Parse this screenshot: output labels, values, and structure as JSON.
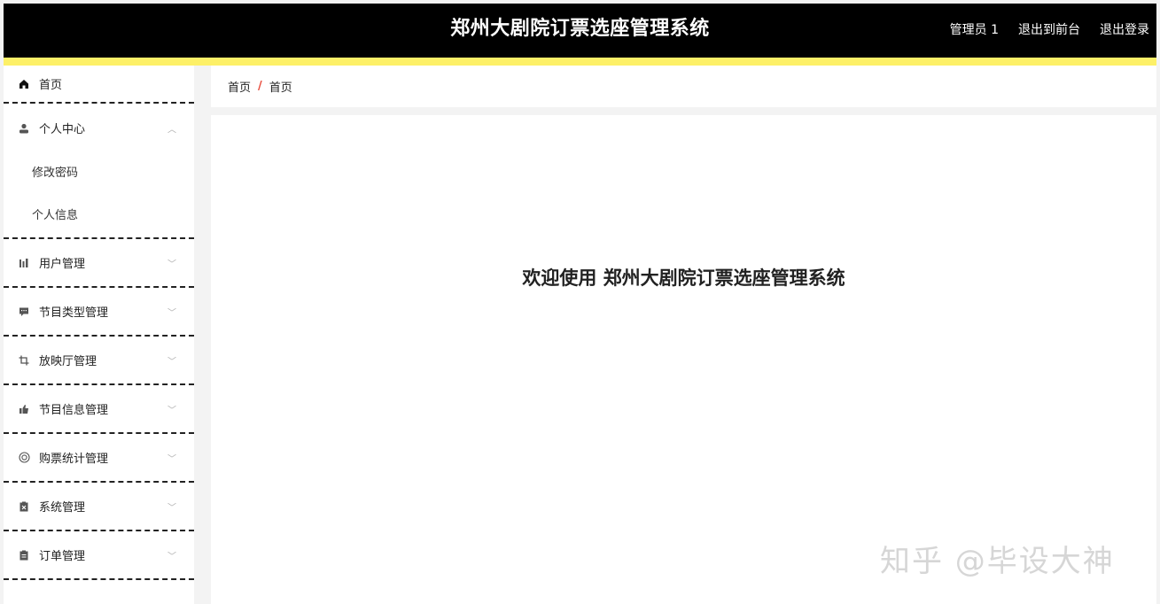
{
  "header": {
    "title": "郑州大剧院订票选座管理系统",
    "user": "管理员 1",
    "back_front": "退出到前台",
    "logout": "退出登录"
  },
  "sidebar": {
    "home": {
      "label": "首页",
      "icon": "home-icon"
    },
    "personal": {
      "label": "个人中心",
      "icon": "user-icon",
      "children": [
        "修改密码",
        "个人信息"
      ]
    },
    "items": [
      {
        "label": "用户管理",
        "icon": "bar-chart-icon"
      },
      {
        "label": "节目类型管理",
        "icon": "message-icon"
      },
      {
        "label": "放映厅管理",
        "icon": "crop-icon"
      },
      {
        "label": "节目信息管理",
        "icon": "thumb-icon"
      },
      {
        "label": "购票统计管理",
        "icon": "lifebuoy-icon"
      },
      {
        "label": "系统管理",
        "icon": "clipboard-x-icon"
      },
      {
        "label": "订单管理",
        "icon": "clipboard-icon"
      }
    ]
  },
  "breadcrumb": {
    "first": "首页",
    "sep": "/",
    "second": "首页"
  },
  "main": {
    "welcome": "欢迎使用 郑州大剧院订票选座管理系统"
  },
  "watermark": "知乎 @毕设大神",
  "colors": {
    "topbar": "#000000",
    "accent": "#fdf067",
    "breadcrumb_sep": "#e84a3a"
  }
}
